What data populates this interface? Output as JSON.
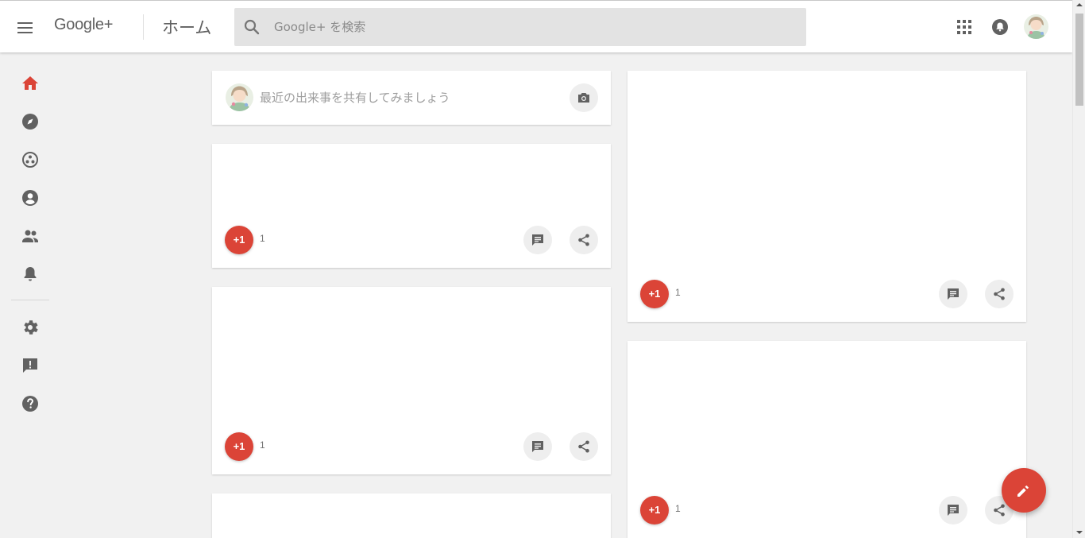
{
  "header": {
    "logo_text": "Google+",
    "page_title": "ホーム",
    "search_placeholder": "Google+ を検索",
    "accent_color": "#db4437"
  },
  "sidebar": {
    "items": [
      {
        "icon": "home-icon",
        "active": true
      },
      {
        "icon": "compass-icon"
      },
      {
        "icon": "communities-icon"
      },
      {
        "icon": "profile-icon"
      },
      {
        "icon": "people-icon"
      },
      {
        "icon": "notifications-icon"
      },
      {
        "icon": "settings-icon"
      },
      {
        "icon": "feedback-icon"
      },
      {
        "icon": "help-icon"
      }
    ]
  },
  "share_box": {
    "prompt": "最近の出来事を共有してみましょう"
  },
  "posts": [
    {
      "plus_label": "+1",
      "plus_count": "1"
    },
    {
      "plus_label": "+1",
      "plus_count": "1"
    },
    {
      "plus_label": "+1",
      "plus_count": "1"
    },
    {
      "plus_label": "+1",
      "plus_count": "1"
    }
  ]
}
